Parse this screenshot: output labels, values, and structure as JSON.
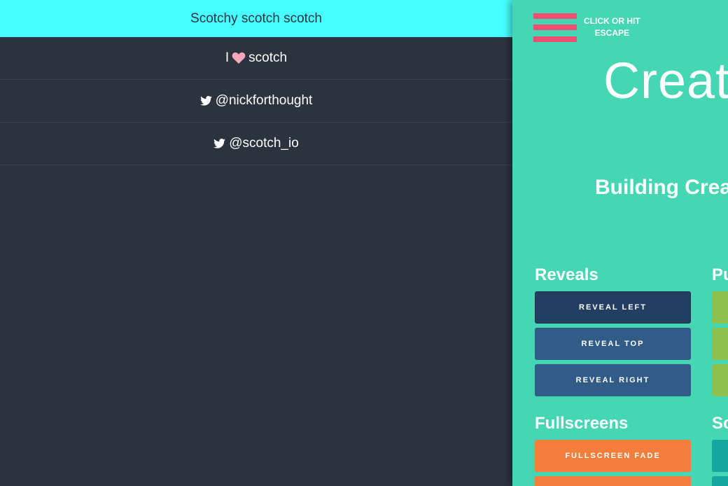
{
  "menu": {
    "title": "Scotchy scotch scotch",
    "items": [
      {
        "prefix": "I",
        "icon": "heart-icon",
        "suffix": "scotch"
      },
      {
        "icon": "twitter-icon",
        "label": "@nickforthought"
      },
      {
        "icon": "twitter-icon",
        "label": "@scotch_io"
      }
    ]
  },
  "content": {
    "hamburger_icon": "hamburger-icon",
    "hint": [
      "CLICK OR HIT",
      "ESCAPE"
    ],
    "hero_title": "Creat",
    "hero_subtitle": "Building Creati",
    "sections": {
      "reveals": {
        "title": "Reveals",
        "buttons": [
          "REVEAL LEFT",
          "REVEAL TOP",
          "REVEAL RIGHT"
        ]
      },
      "pushes": {
        "title": "Pu"
      },
      "fullscreens": {
        "title": "Fullscreens",
        "buttons": [
          "FULLSCREEN FADE"
        ]
      },
      "slides": {
        "title": "Sc"
      }
    }
  },
  "colors": {
    "menu_bg": "#2b333e",
    "menu_title_bg": "#47ffff",
    "content_bg": "#45d6b3",
    "accent_pink": "#ef4e6f",
    "heart": "#f7a8b8",
    "reveal_active": "#223e60",
    "reveal": "#325c88",
    "push_green": "#8dc04d",
    "fullscreen_orange": "#f47f3d",
    "slide_teal": "#16a6a0"
  }
}
